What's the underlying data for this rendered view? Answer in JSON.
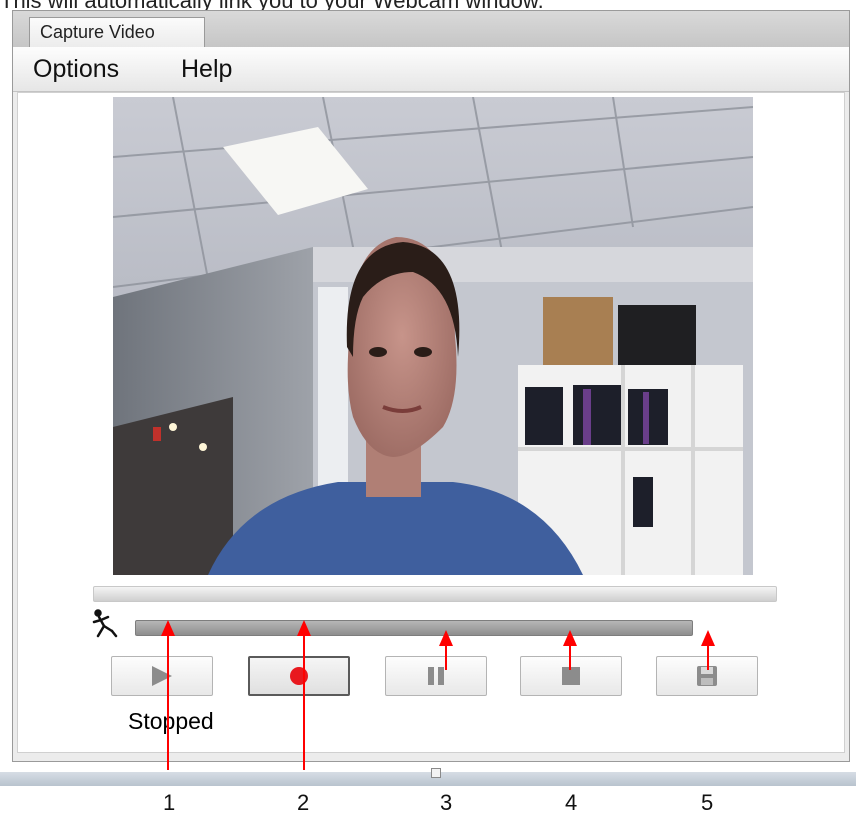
{
  "caption": "This will automatically link you to your Webcam window.",
  "window": {
    "tab_label": "Capture Video",
    "menu": [
      "Options",
      "Help"
    ]
  },
  "player": {
    "status": "Stopped",
    "buttons": [
      {
        "name": "play",
        "icon": "play-icon"
      },
      {
        "name": "record",
        "icon": "record-icon"
      },
      {
        "name": "pause",
        "icon": "pause-icon"
      },
      {
        "name": "stop",
        "icon": "stop-icon"
      },
      {
        "name": "save",
        "icon": "floppy-disk-icon"
      }
    ],
    "colors": {
      "record": "#e8191f",
      "icon_gray": "#8c8c8c"
    }
  },
  "annotations": {
    "numbers": [
      "1",
      "2",
      "3",
      "4",
      "5"
    ],
    "arrow_color": "#ff0000"
  }
}
